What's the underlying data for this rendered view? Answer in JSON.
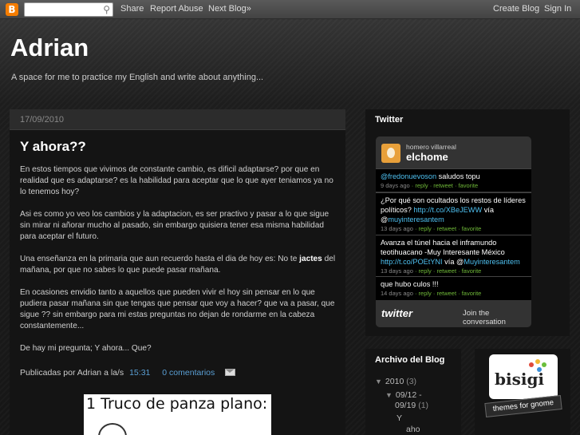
{
  "navbar": {
    "logo": "B",
    "search_placeholder": "",
    "share": "Share",
    "report_abuse": "Report Abuse",
    "next_blog": "Next Blog»",
    "create_blog": "Create Blog",
    "sign_in": "Sign In"
  },
  "header": {
    "title": "Adrian",
    "description": "A space for me to practice my English and write about anything..."
  },
  "post": {
    "date": "17/09/2010",
    "title": "Y ahora??",
    "paragraphs": [
      "En estos tiempos que vivimos de constante cambio, es dificil adaptarse? por que en realidad que es adaptarse? es la habilidad para aceptar que lo que ayer teniamos ya no lo tenemos hoy?",
      "Asi es como yo veo los cambios y la adaptacion, es ser practivo y pasar a lo que sigue sin mirar ni añorar mucho al pasado, sin embargo quisiera tener esa misma habilidad para aceptar el futuro.",
      "En ocasiones envidio tanto a aquellos que pueden vivir el hoy sin pensar en lo que pudiera pasar mañana sin que tengas que pensar que voy a hacer? que va a pasar, que sigue ?? sin embargo para mi estas preguntas no dejan de rondarme en la cabeza constantemente...",
      "De hay mi pregunta; Y ahora... Que?"
    ],
    "p3_before": "Una enseñanza en la primaria que aun recuerdo hasta el dia de hoy es: No te ",
    "p3_bold": "jactes",
    "p3_after": " del mañana, por que no sabes lo que puede pasar mañana.",
    "footer_prefix": "Publicadas por Adrian a la/s",
    "time": "15:31",
    "comments": "0 comentarios",
    "image_text": "1 Truco de panza plano:"
  },
  "twitter": {
    "heading": "Twitter",
    "real_name": "homero villarreal",
    "username": "elchome",
    "tweets": [
      {
        "pre": "",
        "link": "@fredonuevoson",
        "post": " saludos topu",
        "time": "9 days ago",
        "actions": "reply · retweet · favorite"
      },
      {
        "pre": "¿Por qué son ocultados los restos de líderes políticos? ",
        "link": "http://t.co/XBeJEWW",
        "post": " vía @",
        "link2": "muyinteresantem",
        "time": "13 days ago",
        "actions": "reply · retweet · favorite"
      },
      {
        "pre": "Avanza el túnel hacia el inframundo teotihuacano -Muy Interesante México ",
        "link": "http://t.co/POEtYNI",
        "post": " vía @",
        "link2": "Muyinteresantem",
        "time": "13 days ago",
        "actions": "reply · retweet · favorite"
      },
      {
        "pre": "que hubo culos !!!",
        "link": "",
        "post": "",
        "time": "14 days ago",
        "actions": "reply · retweet · favorite"
      }
    ],
    "logo": "twitter",
    "join": "Join the conversation"
  },
  "archive": {
    "heading": "Archivo del Blog",
    "year": "2010",
    "year_count": "(3)",
    "week": "09/12 -",
    "week2": "09/19",
    "week_count": "(1)",
    "post_line1": "Y",
    "post_line2": "aho"
  },
  "badge": {
    "brand": "bisigi",
    "ribbon": "themes for gnome"
  },
  "colors": {
    "accent_link": "#5a9fd4",
    "twitter_link": "#4ec0f0",
    "twitter_meta": "#6fb838"
  }
}
